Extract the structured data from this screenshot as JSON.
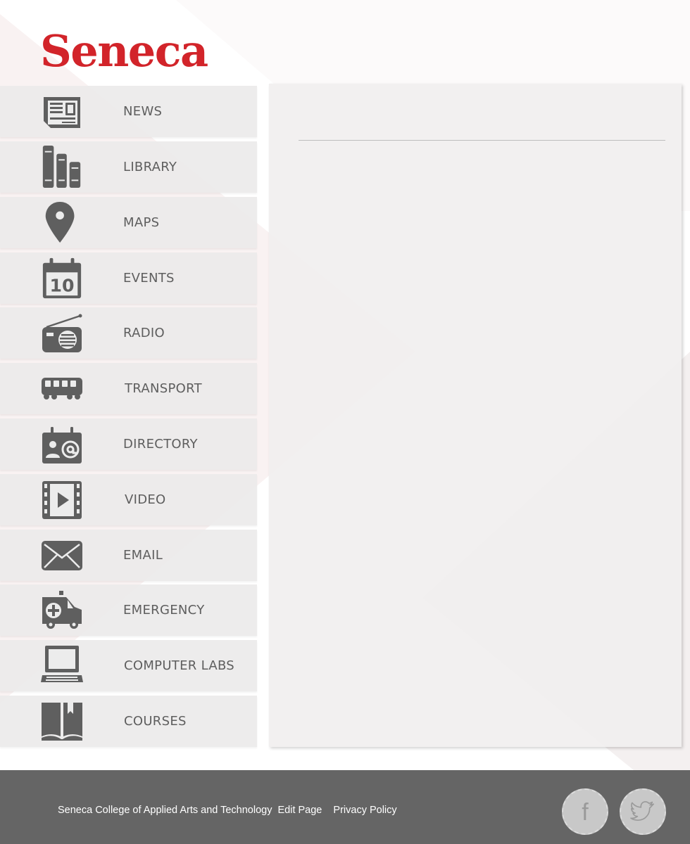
{
  "brand": {
    "logo_text": "Seneca",
    "accent_color": "#d2242a"
  },
  "nav": {
    "items": [
      {
        "label": "NEWS",
        "icon": "newspaper-icon"
      },
      {
        "label": "LIBRARY",
        "icon": "books-icon"
      },
      {
        "label": "MAPS",
        "icon": "map-pin-icon"
      },
      {
        "label": "EVENTS",
        "icon": "calendar-icon"
      },
      {
        "label": "RADIO",
        "icon": "radio-icon"
      },
      {
        "label": "TRANSPORT",
        "icon": "bus-icon"
      },
      {
        "label": "DIRECTORY",
        "icon": "contact-card-icon"
      },
      {
        "label": "VIDEO",
        "icon": "film-play-icon"
      },
      {
        "label": "EMAIL",
        "icon": "envelope-icon"
      },
      {
        "label": "EMERGENCY",
        "icon": "ambulance-icon"
      },
      {
        "label": "COMPUTER LABS",
        "icon": "laptop-icon"
      },
      {
        "label": "COURSES",
        "icon": "open-book-icon"
      }
    ],
    "calendar_day": "10"
  },
  "footer": {
    "college": "Seneca College of Applied Arts and Technology",
    "edit_link": "Edit Page",
    "privacy_link": "Privacy Policy",
    "facebook_letter": "f",
    "social": [
      "facebook-icon",
      "twitter-icon"
    ],
    "background_color": "#656565"
  },
  "icon_color": "#5f5f5f"
}
